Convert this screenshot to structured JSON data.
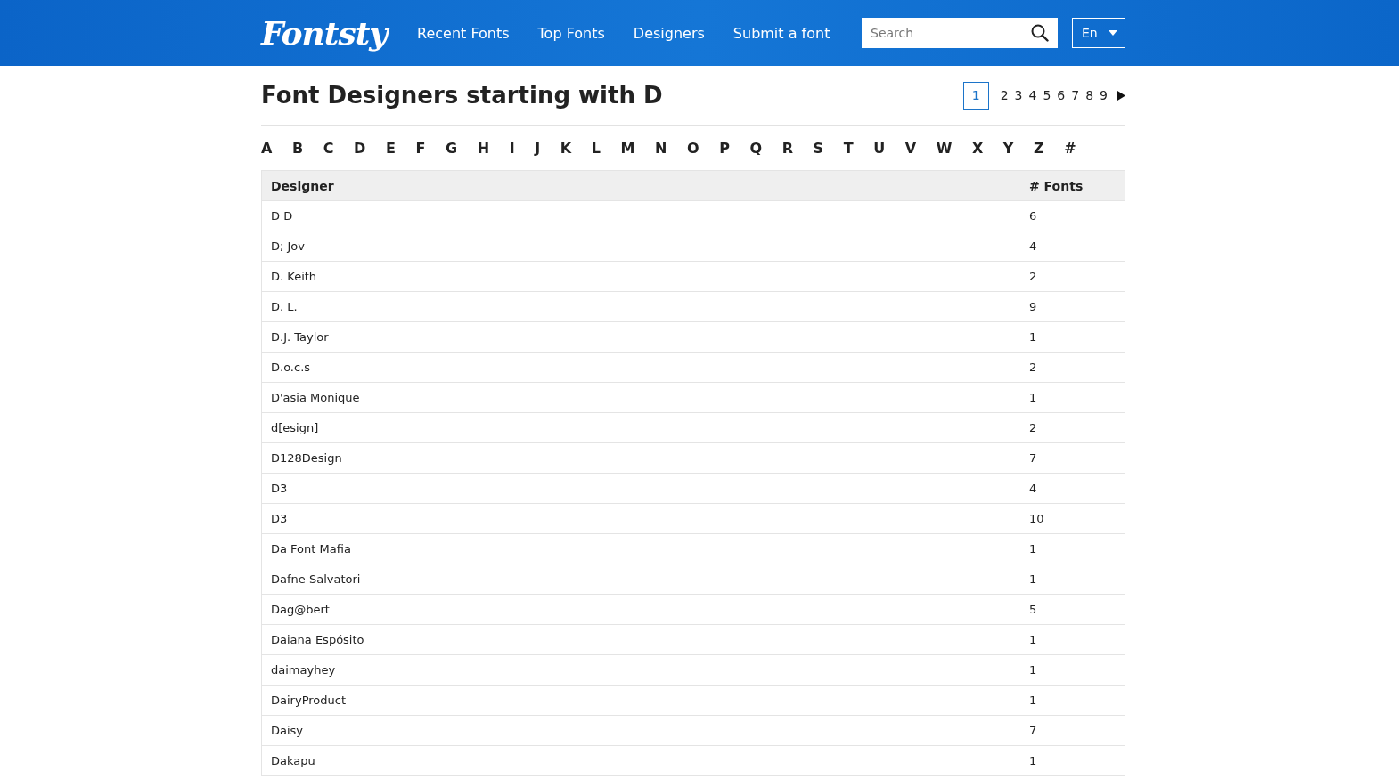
{
  "header": {
    "logo": "Fontsty",
    "nav": [
      {
        "label": "Recent Fonts",
        "selected": false
      },
      {
        "label": "Top Fonts",
        "selected": false
      },
      {
        "label": "Designers",
        "selected": false
      },
      {
        "label": "Submit a font",
        "selected": false
      }
    ],
    "search": {
      "placeholder": "Search"
    },
    "language": "En"
  },
  "title": "Font Designers starting with D",
  "pagination": [
    {
      "label": "1",
      "selected": true
    },
    {
      "label": "2",
      "selected": false
    },
    {
      "label": "3",
      "selected": false
    },
    {
      "label": "4",
      "selected": false
    },
    {
      "label": "5",
      "selected": false
    },
    {
      "label": "6",
      "selected": false
    },
    {
      "label": "7",
      "selected": false
    },
    {
      "label": "8",
      "selected": false
    },
    {
      "label": "9",
      "selected": false
    }
  ],
  "letters": [
    "A",
    "B",
    "C",
    "D",
    "E",
    "F",
    "G",
    "H",
    "I",
    "J",
    "K",
    "L",
    "M",
    "N",
    "O",
    "P",
    "Q",
    "R",
    "S",
    "T",
    "U",
    "V",
    "W",
    "X",
    "Y",
    "Z",
    "#"
  ],
  "table": {
    "columns": [
      "Designer",
      "# Fonts"
    ],
    "rows": [
      [
        "D D",
        "6"
      ],
      [
        "D; Jov",
        "4"
      ],
      [
        "D. Keith",
        "2"
      ],
      [
        "D. L.",
        "9"
      ],
      [
        "D.J. Taylor",
        "1"
      ],
      [
        "D.o.c.s",
        "2"
      ],
      [
        "D'asia Monique",
        "1"
      ],
      [
        "d[esign]",
        "2"
      ],
      [
        "D128Design",
        "7"
      ],
      [
        "D3",
        "4"
      ],
      [
        "D3",
        "10"
      ],
      [
        "Da Font Mafia",
        "1"
      ],
      [
        "Dafne Salvatori",
        "1"
      ],
      [
        "Dag@bert",
        "5"
      ],
      [
        "Daiana Espósito",
        "1"
      ],
      [
        "daimayhey",
        "1"
      ],
      [
        "DairyProduct",
        "1"
      ],
      [
        "Daisy",
        "7"
      ],
      [
        "Dakapu",
        "1"
      ]
    ]
  }
}
